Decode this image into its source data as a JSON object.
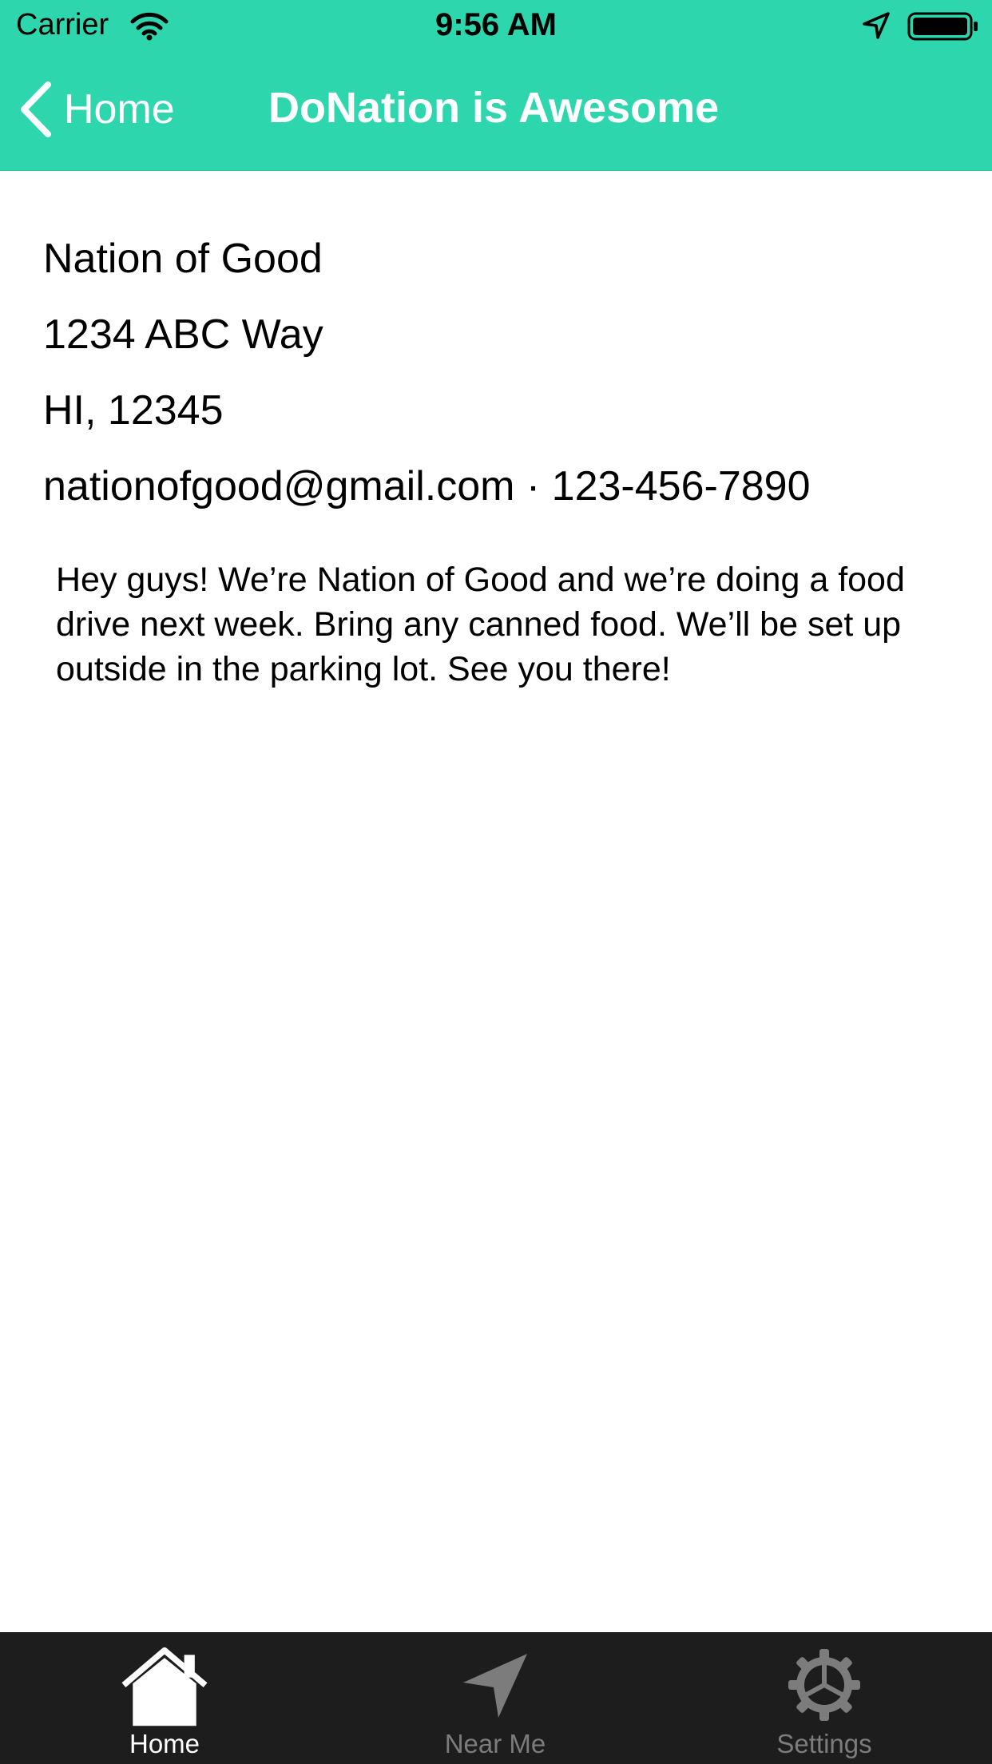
{
  "status_bar": {
    "carrier": "Carrier",
    "time": "9:56 AM"
  },
  "nav": {
    "back_label": "Home",
    "title": "DoNation is Awesome"
  },
  "organization": {
    "name": "Nation of Good",
    "street": "1234 ABC Way",
    "state_zip": "HI, 12345",
    "contact": "nationofgood@gmail.com · 123-456-7890",
    "description": "Hey guys! We’re Nation of Good and we’re doing a food drive next week. Bring any canned food. We’ll be set up outside in the parking lot. See you there!"
  },
  "tabs": [
    {
      "label": "Home",
      "icon": "home-icon",
      "active": true
    },
    {
      "label": "Near Me",
      "icon": "navigation-arrow-icon",
      "active": false
    },
    {
      "label": "Settings",
      "icon": "gear-icon",
      "active": false
    }
  ],
  "colors": {
    "accent": "#2dd6ad",
    "tab_bar": "#1d1d1d",
    "tab_active": "#ffffff",
    "tab_inactive": "#7c7c7c"
  }
}
